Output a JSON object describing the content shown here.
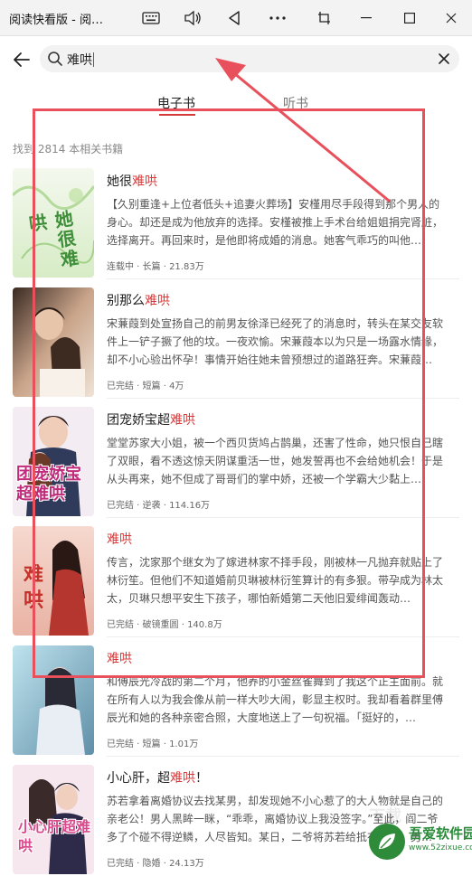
{
  "window": {
    "title": "阅读快看版 - 阅读小说"
  },
  "search": {
    "query": "难哄"
  },
  "tabs": [
    {
      "label": "电子书",
      "active": true
    },
    {
      "label": "听书",
      "active": false
    }
  ],
  "result_count": "找到 2814 本相关书籍",
  "books": [
    {
      "title_pre": "她很",
      "title_hl": "难哄",
      "title_post": "",
      "desc": "【久别重逢+上位者低头+追妻火葬场】安槿用尽手段得到那个男人的身心。却还是成为他放弃的选择。安槿被推上手术台给姐姐捐完肾脏，选择离开。再回来时，是他即将成婚的消息。她客气乖巧的叫他…",
      "meta": "连载中 · 长篇 · 21.83万",
      "cover_text": "她很难哄"
    },
    {
      "title_pre": "别那么",
      "title_hl": "难哄",
      "title_post": "",
      "desc": "宋蒹葭到处宣扬自己的前男友徐泽已经死了的消息时，转头在某交友软件上一铲子撅了他的坟。一夜欢愉。宋蒹葭本以为只是一场露水情缘，却不小心验出怀孕！事情开始往她未曾预想过的道路狂奔。宋蒹葭…",
      "meta": "已完结 · 短篇 · 4万",
      "cover_text": ""
    },
    {
      "title_pre": "团宠娇宝超",
      "title_hl": "难哄",
      "title_post": "",
      "desc": "堂堂苏家大小姐，被一个西贝货鸠占鹊巢，还害了性命，她只恨自己瞎了双眼，看不透这惊天阴谋重活一世，她发誓再也不会给她机会！于是从头再来，她不但成了哥哥们的掌中娇，还被一个学霸大少黏上…",
      "meta": "已完结 · 逆袭 · 114.16万",
      "cover_text": "团宠娇宝超难哄"
    },
    {
      "title_pre": "",
      "title_hl": "难哄",
      "title_post": "",
      "desc": "传言，沈家那个继女为了嫁进林家不择手段，刚被林一凡抛弃就贴上了林衍笙。但他们不知道婚前贝琳被林衍笙算计的有多狠。带孕成为林太太，贝琳只想平安生下孩子，哪怕新婚第二天他旧爱绯闻轰动…",
      "meta": "已完结 · 破镜重圆 · 140.8万",
      "cover_text": "难哄"
    },
    {
      "title_pre": "",
      "title_hl": "难哄",
      "title_post": "",
      "desc": "和傅辰光冷战的第二个月，他养的小金丝雀舞到了我这个正主面前。就在所有人以为我会像从前一样大吵大闹，彰显主权时。我却看着群里傅辰光和她的各种亲密合照，大度地送上了一句祝福。「挺好的，…",
      "meta": "已完结 · 短篇 · 1.01万",
      "cover_text": ""
    },
    {
      "title_pre": "小心肝，超",
      "title_hl": "难哄",
      "title_post": "！",
      "desc": "苏若拿着离婚协议去找某男，却发现她不小心惹了的大人物就是自己的亲老公！男人黑眸一眯，“乖乖，离婚协议上我没签字。”至此，阎二爷多了个碰不得逆鳞，人尽皆知。某日，二爷将苏若给抵在墙上，男…",
      "meta": "已完结 · 隐婚 · 24.13万",
      "cover_text": "小心肝超难哄"
    }
  ],
  "watermark": {
    "name": "吾爱软件园",
    "url": "www.52zixue.com",
    "ghost": "下载"
  },
  "colors": {
    "accent": "#d83b3b",
    "annotation": "#e8505b"
  }
}
